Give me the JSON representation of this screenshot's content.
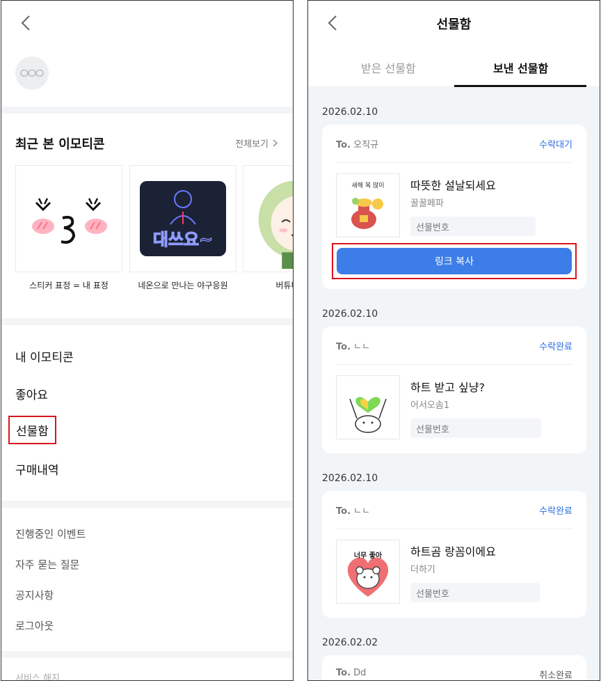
{
  "left": {
    "recent": {
      "title": "최근 본 이모티콘",
      "view_all": "전체보기",
      "items": [
        {
          "label": "스티커 표정 = 내 표정"
        },
        {
          "label": "네온으로 만나는 야구응원",
          "thumb_text": "대쓰요~"
        },
        {
          "label": "버튜버 준비"
        }
      ]
    },
    "menu": {
      "my_emoticons": "내 이모티콘",
      "likes": "좋아요",
      "gift_box": "선물함",
      "purchases": "구매내역"
    },
    "support": {
      "events": "진행중인 이벤트",
      "faq": "자주 묻는 질문",
      "notices": "공지사항",
      "logout": "로그아웃",
      "cancel_service": "서비스 해지"
    }
  },
  "right": {
    "header": {
      "title": "선물함"
    },
    "tabs": {
      "received": "받은 선물함",
      "sent": "보낸 선물함"
    },
    "gifts": [
      {
        "date": "2026.02.10",
        "to_prefix": "To.",
        "to_name": "오직규",
        "status": "수락대기",
        "name": "따뜻한 설날되세요",
        "brand": "꿀꿀페파",
        "code_label": "선물번호",
        "thumb_text": "새해 복 많이",
        "copy_button": "링크 복사"
      },
      {
        "date": "2026.02.10",
        "to_prefix": "To.",
        "to_name": "ㄴㄴ",
        "status": "수락완료",
        "name": "하트 받고 싶냥?",
        "brand": "어서오솜1",
        "code_label": "선물번호"
      },
      {
        "date": "2026.02.10",
        "to_prefix": "To.",
        "to_name": "ㄴㄴ",
        "status": "수락완료",
        "name": "하트곰 랑꼼이에요",
        "brand": "더하기",
        "code_label": "선물번호",
        "thumb_text": "너무 좋아"
      },
      {
        "date": "2026.02.02",
        "to_prefix": "To.",
        "to_name": "Dd",
        "status": "취소완료"
      }
    ]
  },
  "colors": {
    "accent": "#2d6de0",
    "button": "#3d7de8",
    "highlight": "#d9141b",
    "list_bg": "#f2f5f8"
  }
}
